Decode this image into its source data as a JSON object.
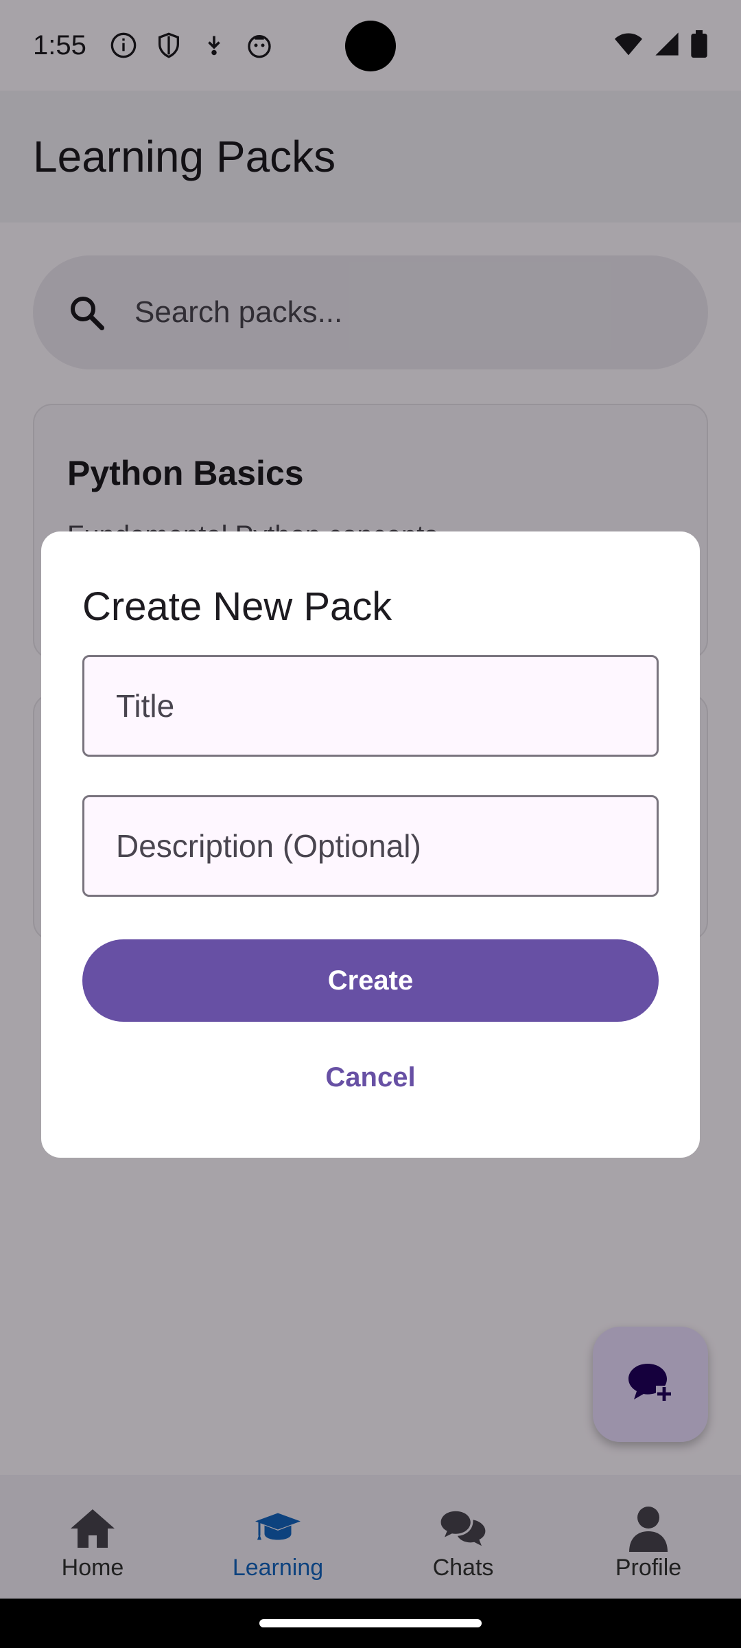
{
  "status_bar": {
    "time": "1:55",
    "icons": [
      "info-icon",
      "shield-icon",
      "download-icon",
      "robot-icon"
    ],
    "right_icons": [
      "wifi-icon",
      "signal-icon",
      "battery-icon"
    ]
  },
  "app_bar": {
    "title": "Learning Packs"
  },
  "search": {
    "placeholder": "Search packs..."
  },
  "cards": [
    {
      "title": "Python Basics",
      "description": "Fundamental Python concepts"
    }
  ],
  "dialog": {
    "title": "Create New Pack",
    "title_field_placeholder": "Title",
    "description_field_placeholder": "Description (Optional)",
    "create_label": "Create",
    "cancel_label": "Cancel"
  },
  "bottom_nav": {
    "items": [
      {
        "label": "Home",
        "icon": "home-icon"
      },
      {
        "label": "Learning",
        "icon": "graduation-cap-icon"
      },
      {
        "label": "Chats",
        "icon": "chat-bubbles-icon"
      },
      {
        "label": "Profile",
        "icon": "person-icon"
      }
    ],
    "active": "Learning"
  },
  "fab": {
    "icon": "new-chat-icon"
  },
  "colors": {
    "primary": "#6750A4",
    "active_nav": "#1565C0",
    "fab_bg": "#EADDFF"
  }
}
